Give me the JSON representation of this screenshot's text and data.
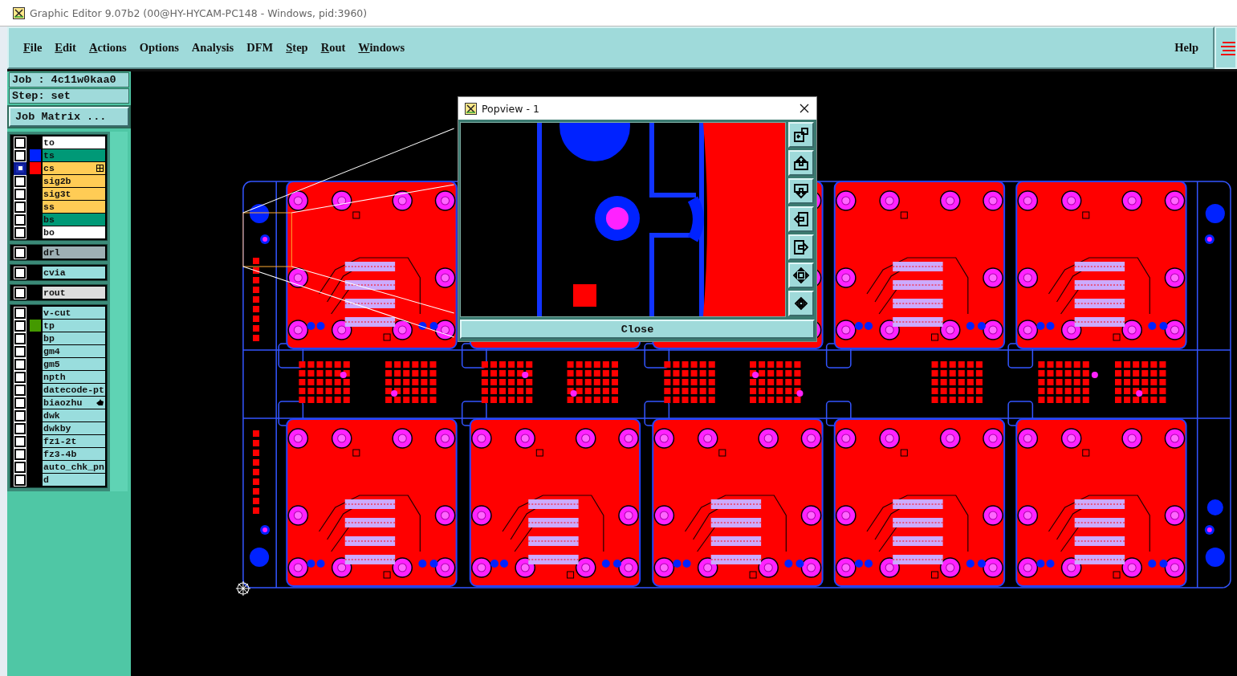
{
  "window": {
    "title": "Graphic Editor 9.07b2 (00@HY-HYCAM-PC148 - Windows, pid:3960)"
  },
  "menus": [
    {
      "label": "File",
      "mnemonic": true
    },
    {
      "label": "Edit",
      "mnemonic": true
    },
    {
      "label": "Actions",
      "mnemonic": true
    },
    {
      "label": "Options",
      "mnemonic": false
    },
    {
      "label": "Analysis",
      "mnemonic": false
    },
    {
      "label": "DFM",
      "mnemonic": false
    },
    {
      "label": "Step",
      "mnemonic": true
    },
    {
      "label": "Rout",
      "mnemonic": true
    },
    {
      "label": "Windows",
      "mnemonic": true
    }
  ],
  "help": "Help",
  "job": "Job : 4c11w0kaa0",
  "step": "Step: set",
  "job_matrix": "Job Matrix ...",
  "layer_groups": [
    {
      "layers": [
        {
          "name": "to",
          "color": "#ffffff",
          "kind": "plain",
          "active": false
        },
        {
          "name": "ts",
          "color": "#009977",
          "kind": "plain",
          "swatch": {
            "color": "#0022ff"
          },
          "active": false
        },
        {
          "name": "cs",
          "color": "#ffcc55",
          "kind": "grid",
          "swatch": {
            "color": "#ff0000"
          },
          "active": true
        },
        {
          "name": "sig2b",
          "color": "#ffcc55",
          "kind": "plain",
          "active": false
        },
        {
          "name": "sig3t",
          "color": "#ffcc55",
          "kind": "plain",
          "active": false
        },
        {
          "name": "ss",
          "color": "#ffcc55",
          "kind": "plain",
          "active": false
        },
        {
          "name": "bs",
          "color": "#009977",
          "kind": "plain",
          "active": false
        },
        {
          "name": "bo",
          "color": "#ffffff",
          "kind": "plain",
          "active": false
        }
      ]
    },
    {
      "layers": [
        {
          "name": "drl",
          "color": "#9eb0b4",
          "kind": "plain",
          "active": false
        }
      ]
    },
    {
      "layers": [
        {
          "name": "cvia",
          "color": "#99dddd",
          "kind": "plain",
          "active": false
        }
      ]
    },
    {
      "layers": [
        {
          "name": "rout",
          "color": "#dddddd",
          "kind": "plain",
          "active": false
        }
      ]
    },
    {
      "layers": [
        {
          "name": "v-cut",
          "color": "#99dddd",
          "kind": "plain",
          "active": false
        },
        {
          "name": "tp",
          "color": "#99dddd",
          "kind": "plain",
          "swatch": {
            "color": "#449900"
          },
          "active": false
        },
        {
          "name": "bp",
          "color": "#99dddd",
          "kind": "plain",
          "active": false
        },
        {
          "name": "gm4",
          "color": "#99dddd",
          "kind": "plain",
          "active": false
        },
        {
          "name": "gm5",
          "color": "#99dddd",
          "kind": "plain",
          "active": false
        },
        {
          "name": "npth",
          "color": "#99dddd",
          "kind": "plain",
          "active": false
        },
        {
          "name": "datecode-pt",
          "color": "#99dddd",
          "kind": "plain",
          "active": false
        },
        {
          "name": "biaozhu",
          "color": "#99dddd",
          "kind": "pointer",
          "active": false
        },
        {
          "name": "dwk",
          "color": "#99dddd",
          "kind": "plain",
          "active": false
        },
        {
          "name": "dwkby",
          "color": "#99dddd",
          "kind": "plain",
          "active": false
        },
        {
          "name": "fz1-2t",
          "color": "#99dddd",
          "kind": "plain",
          "active": false
        },
        {
          "name": "fz3-4b",
          "color": "#99dddd",
          "kind": "plain",
          "active": false
        },
        {
          "name": "auto_chk_pn",
          "color": "#99dddd",
          "kind": "plain",
          "active": false
        },
        {
          "name": "d",
          "color": "#99dddd",
          "kind": "plain",
          "active": false
        }
      ]
    }
  ],
  "popview": {
    "title": "Popview - 1",
    "close": "Close"
  }
}
